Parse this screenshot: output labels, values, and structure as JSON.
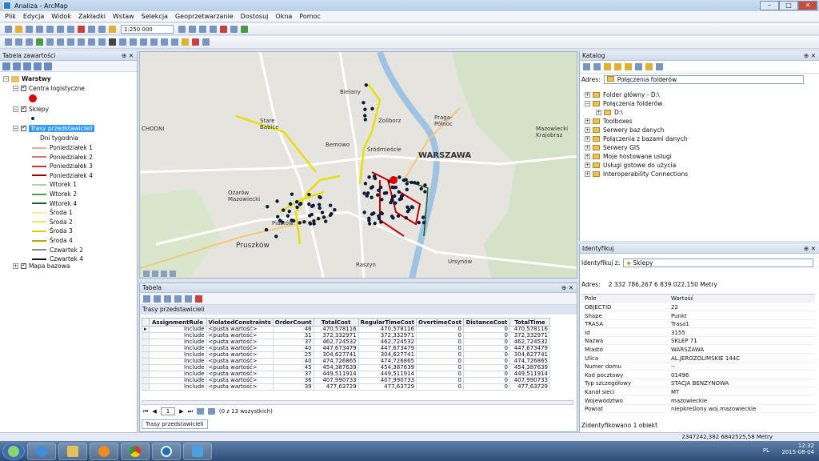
{
  "window": {
    "title": "Analiza - ArcMap"
  },
  "menu": [
    "Plik",
    "Edycja",
    "Widok",
    "Zakładki",
    "Wstaw",
    "Selekcja",
    "Geoprzetwarzanie",
    "Dostosuj",
    "Okna",
    "Pomoc"
  ],
  "toolbar": {
    "scale": "1:250 000"
  },
  "toc": {
    "title": "Tabela zawartości",
    "root": "Warstwy",
    "layer1": "Centra logistyczne",
    "layer2": "Sklepy",
    "layer3": "Trasy przedstawicieli",
    "group_label": "Dni tygodnia",
    "routes": [
      {
        "label": "Poniedziałek 1",
        "color": "#f0a8a8"
      },
      {
        "label": "Poniedziałek 2",
        "color": "#e07070"
      },
      {
        "label": "Poniedziałek 3",
        "color": "#d03030"
      },
      {
        "label": "Poniedziałek 4",
        "color": "#a00000"
      },
      {
        "label": "Wtorek 1",
        "color": "#a8d8a8"
      },
      {
        "label": "Wtorek 2",
        "color": "#50a050"
      },
      {
        "label": "Wtorek 4",
        "color": "#1e5e1e"
      },
      {
        "label": "Środa 1",
        "color": "#f5f0a0"
      },
      {
        "label": "Środa 2",
        "color": "#f0e850"
      },
      {
        "label": "Środa 3",
        "color": "#e0d000"
      },
      {
        "label": "Środa 4",
        "color": "#b8a800"
      },
      {
        "label": "Czwartek 2",
        "color": "#888888"
      },
      {
        "label": "Czwartek 4",
        "color": "#111111"
      }
    ],
    "basemap": "Mapa bazowa"
  },
  "map": {
    "labels": [
      {
        "text": "Bielany"
      },
      {
        "text": "Żoliborz"
      },
      {
        "text": "Praga-\nPółnoc"
      },
      {
        "text": "Bemowo"
      },
      {
        "text": "Stare\nBabice"
      },
      {
        "text": "Śródmieście"
      },
      {
        "text": "WARSZAWA"
      },
      {
        "text": "Ożarów\nMazowiecki"
      },
      {
        "text": "Pruszków"
      },
      {
        "text": "Piastów"
      },
      {
        "text": "Ursynów"
      },
      {
        "text": "Raszyn"
      },
      {
        "text": "Mazowiecki\nKrajobraz"
      },
      {
        "text": "CHODNI"
      }
    ]
  },
  "table": {
    "title": "Tabela",
    "tab_title": "Trasy przedstawicieli",
    "columns": [
      "AssignmentRule",
      "ViolatedConstraints",
      "OrderCount",
      "TotalCost",
      "RegularTimeCost",
      "OvertimeCost",
      "DistanceCost",
      "TotalTime"
    ],
    "rows": [
      [
        "Include",
        "<pusta wartość>",
        "46",
        "470,578116",
        "470,578116",
        "0",
        "0",
        "470,578116"
      ],
      [
        "Include",
        "<pusta wartość>",
        "31",
        "372,332971",
        "372,332971",
        "0",
        "0",
        "372,332971"
      ],
      [
        "Include",
        "<pusta wartość>",
        "37",
        "462,724532",
        "462,724532",
        "0",
        "0",
        "462,724532"
      ],
      [
        "Include",
        "<pusta wartość>",
        "40",
        "447,673479",
        "447,673479",
        "0",
        "0",
        "447,673479"
      ],
      [
        "Include",
        "<pusta wartość>",
        "25",
        "304,627741",
        "304,627741",
        "0",
        "0",
        "304,627741"
      ],
      [
        "Include",
        "<pusta wartość>",
        "40",
        "474,726865",
        "474,726865",
        "0",
        "0",
        "474,726865"
      ],
      [
        "Include",
        "<pusta wartość>",
        "45",
        "454,387639",
        "454,387639",
        "0",
        "0",
        "454,387639"
      ],
      [
        "Include",
        "<pusta wartość>",
        "37",
        "449,511914",
        "449,511914",
        "0",
        "0",
        "449,511914"
      ],
      [
        "Include",
        "<pusta wartość>",
        "36",
        "407,990733",
        "407,990733",
        "0",
        "0",
        "407,990733"
      ],
      [
        "Include",
        "<pusta wartość>",
        "39",
        "477,63729",
        "477,63729",
        "0",
        "0",
        "477,63729"
      ]
    ],
    "nav_page": "1",
    "record_count": "(0 z 13 wszystkich)",
    "bottom_tab": "Trasy przedstawicieli"
  },
  "catalog": {
    "title": "Katalog",
    "address_label": "Adres:",
    "address_value": "Połączenia folderów",
    "items": [
      "Folder główny - D:\\",
      "Połączenia folderów",
      "D:\\",
      "Toolboxes",
      "Serwery baz danych",
      "Połączenia z bazami danych",
      "Serwery GIS",
      "Moje hostowane usługi",
      "Usługi gotowe do użycia",
      "Interoperability Connections"
    ]
  },
  "identify": {
    "title": "Identyfikuj",
    "from_label": "Identyfikuj z:",
    "from_value": "Sklepy",
    "address_label": "Adres:",
    "address_value": "2 332 786,267  6 839 022,150 Metry",
    "col_field": "Pole",
    "col_value": "Wartość",
    "fields": [
      [
        "OBJECTID",
        "22"
      ],
      [
        "Shape",
        "Punkt"
      ],
      [
        "TRASA",
        "Trasa1"
      ],
      [
        "Id",
        "3155"
      ],
      [
        "Nazwa",
        "SKLEP 71"
      ],
      [
        "Miasto",
        "WARSZAWA"
      ],
      [
        "Ulica",
        "AL.JEROZOLIMSKIE 144C"
      ],
      [
        "Numer domu",
        "--"
      ],
      [
        "Kod pocztowy",
        "01496"
      ],
      [
        "Typ szczegółowy",
        "STACJA BENZYNOWA"
      ],
      [
        "Kanał sieci",
        "MT"
      ],
      [
        "Województwo",
        "mazowieckie"
      ],
      [
        "Powiat",
        "niepkreślony woj.mazowieckie"
      ]
    ],
    "footer": "Zidentyfikowano 1 obiekt"
  },
  "status": {
    "coords": "2347242,382  6842525,58 Metry"
  },
  "tray": {
    "lang": "PL",
    "time": "12:32",
    "date": "2015-08-04"
  }
}
